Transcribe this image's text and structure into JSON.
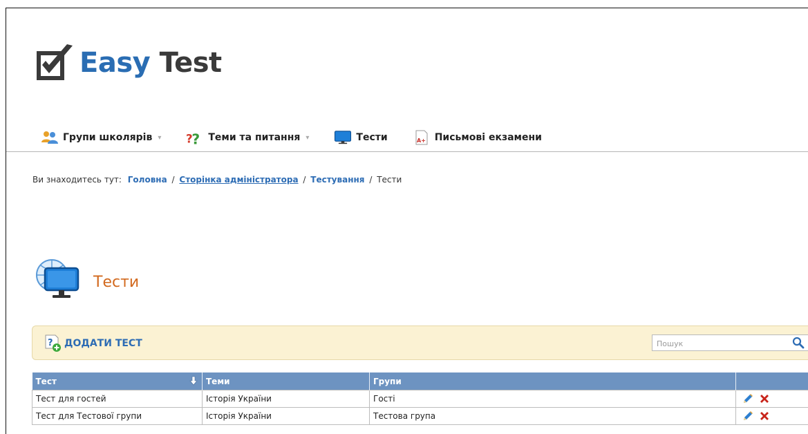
{
  "logo": {
    "word1": "Easy",
    "word2": "Test"
  },
  "nav": {
    "items": [
      {
        "label": "Групи школярів",
        "icon": "users-icon",
        "has_dropdown": true
      },
      {
        "label": "Теми та питання",
        "icon": "question-icon",
        "has_dropdown": true
      },
      {
        "label": "Тести",
        "icon": "monitor-icon",
        "has_dropdown": false
      },
      {
        "label": "Письмові екзамени",
        "icon": "document-grade-icon",
        "has_dropdown": false
      }
    ]
  },
  "breadcrumb": {
    "prefix": "Ви знаходитесь тут:",
    "items": [
      "Головна",
      "Сторінка адміністратора",
      "Тестування"
    ],
    "current": "Тести"
  },
  "page": {
    "title": "Тести"
  },
  "toolbar": {
    "add_label": "ДОДАТИ ТЕСТ",
    "search_placeholder": "Пошук"
  },
  "table": {
    "columns": [
      "Тест",
      "Теми",
      "Групи",
      ""
    ],
    "rows": [
      {
        "test": "Тест для гостей",
        "topics": "Історія України",
        "groups": "Гості"
      },
      {
        "test": "Тест для Тестової групи",
        "topics": "Історія України",
        "groups": "Тестова група"
      }
    ]
  },
  "colors": {
    "accent_blue": "#2d6cb4",
    "header_blue": "#6d93c1",
    "title_orange": "#d2691e",
    "toolbar_bg": "#fbf2d3"
  }
}
